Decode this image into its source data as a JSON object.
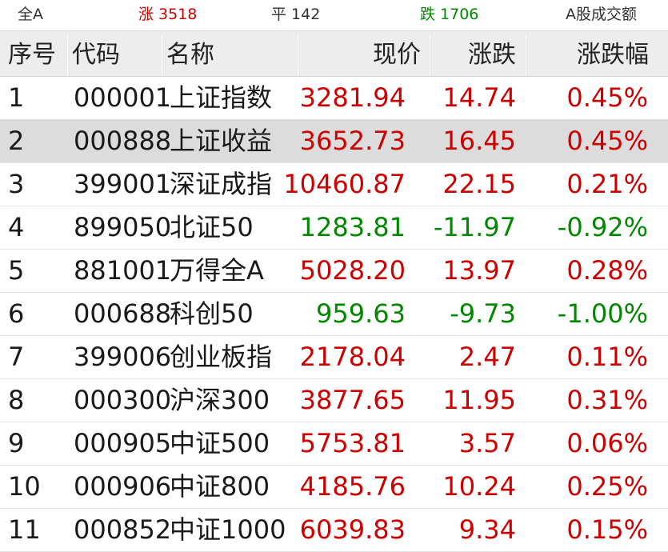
{
  "summary": {
    "all_label": "全A",
    "up_label": "涨 3518",
    "flat_label": "平 142",
    "down_label": "跌 1706",
    "turnover_label": "A股成交额"
  },
  "columns": {
    "idx": "序号",
    "code": "代码",
    "name": "名称",
    "price": "现价",
    "change": "涨跌",
    "pct": "涨跌幅"
  },
  "rows": [
    {
      "idx": "1",
      "code": "000001",
      "name": "上证指数",
      "price": "3281.94",
      "change": "14.74",
      "pct": "0.45%",
      "dir": "up"
    },
    {
      "idx": "2",
      "code": "000888",
      "name": "上证收益",
      "price": "3652.73",
      "change": "16.45",
      "pct": "0.45%",
      "dir": "up"
    },
    {
      "idx": "3",
      "code": "399001",
      "name": "深证成指",
      "price": "10460.87",
      "change": "22.15",
      "pct": "0.21%",
      "dir": "up"
    },
    {
      "idx": "4",
      "code": "899050",
      "name": "北证50",
      "price": "1283.81",
      "change": "-11.97",
      "pct": "-0.92%",
      "dir": "down"
    },
    {
      "idx": "5",
      "code": "881001",
      "name": "万得全A",
      "price": "5028.20",
      "change": "13.97",
      "pct": "0.28%",
      "dir": "up"
    },
    {
      "idx": "6",
      "code": "000688",
      "name": "科创50",
      "price": "959.63",
      "change": "-9.73",
      "pct": "-1.00%",
      "dir": "down"
    },
    {
      "idx": "7",
      "code": "399006",
      "name": "创业板指",
      "price": "2178.04",
      "change": "2.47",
      "pct": "0.11%",
      "dir": "up"
    },
    {
      "idx": "8",
      "code": "000300",
      "name": "沪深300",
      "price": "3877.65",
      "change": "11.95",
      "pct": "0.31%",
      "dir": "up"
    },
    {
      "idx": "9",
      "code": "000905",
      "name": "中证500",
      "price": "5753.81",
      "change": "3.57",
      "pct": "0.06%",
      "dir": "up"
    },
    {
      "idx": "10",
      "code": "000906",
      "name": "中证800",
      "price": "4185.76",
      "change": "10.24",
      "pct": "0.25%",
      "dir": "up"
    },
    {
      "idx": "11",
      "code": "000852",
      "name": "中证1000",
      "price": "6039.83",
      "change": "9.34",
      "pct": "0.15%",
      "dir": "up"
    }
  ],
  "selected_row": 2,
  "colors": {
    "up": "#cc0000",
    "down": "#008800",
    "selected_bg": "#dcdcdc",
    "header_bg": "#ededed"
  }
}
